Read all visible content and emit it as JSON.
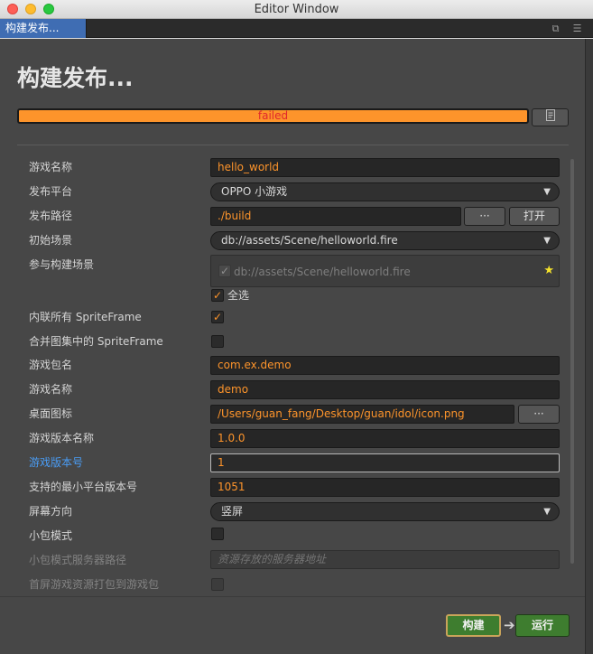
{
  "window": {
    "title": "Editor Window"
  },
  "tab": {
    "label": "构建发布..."
  },
  "panel": {
    "heading": "构建发布...",
    "progress_text": "failed",
    "progress_color": "#fd942b"
  },
  "form": {
    "game_name": {
      "label": "游戏名称",
      "value": "hello_world"
    },
    "platform": {
      "label": "发布平台",
      "value": "OPPO 小游戏"
    },
    "build_path": {
      "label": "发布路径",
      "value": "./build",
      "browse_label": "···",
      "open_label": "打开"
    },
    "start_scene": {
      "label": "初始场景",
      "value": "db://assets/Scene/helloworld.fire"
    },
    "included_scenes": {
      "label": "参与构建场景",
      "scene_path": "db://assets/Scene/helloworld.fire",
      "select_all_label": "全选"
    },
    "inline_spriteframe": {
      "label": "内联所有 SpriteFrame"
    },
    "merge_spriteframe": {
      "label": "合并图集中的 SpriteFrame"
    },
    "package_name": {
      "label": "游戏包名",
      "value": "com.ex.demo"
    },
    "game_name_2": {
      "label": "游戏名称",
      "value": "demo"
    },
    "desktop_icon": {
      "label": "桌面图标",
      "value": "/Users/guan_fang/Desktop/guan/idol/icon.png",
      "browse_label": "···"
    },
    "version_name": {
      "label": "游戏版本名称",
      "value": "1.0.0"
    },
    "version_code": {
      "label": "游戏版本号",
      "value": "1"
    },
    "min_platform": {
      "label": "支持的最小平台版本号",
      "value": "1051"
    },
    "orientation": {
      "label": "屏幕方向",
      "value": "竖屏"
    },
    "subpackage": {
      "label": "小包模式"
    },
    "subpackage_server": {
      "label": "小包模式服务器路径",
      "placeholder": "资源存放的服务器地址"
    },
    "first_screen": {
      "label": "首屏游戏资源打包到游戏包"
    }
  },
  "footer": {
    "build_label": "构建",
    "run_label": "运行"
  },
  "icons": {
    "log": "log-file-icon",
    "star": "star-icon",
    "arrow": "arrow-right-icon"
  }
}
